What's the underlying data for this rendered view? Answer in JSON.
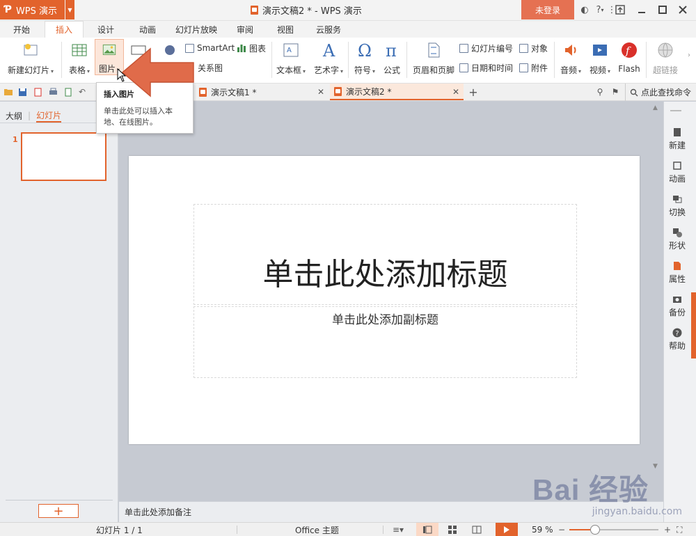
{
  "window": {
    "app_name": "WPS 演示",
    "doc_title": "演示文稿2 * - WPS 演示",
    "login": "未登录",
    "help": "?",
    "help_caret": "▾"
  },
  "tabs": [
    "开始",
    "插入",
    "设计",
    "动画",
    "幻灯片放映",
    "审阅",
    "视图",
    "云服务"
  ],
  "ribbon": {
    "new_slide": "新建幻灯片",
    "table": "表格",
    "picture": "图片",
    "smartart": "SmartArt",
    "chart": "图表",
    "relation": "关系图",
    "textbox": "文本框",
    "wordart": "艺术字",
    "symbol": "符号",
    "formula": "公式",
    "header_footer": "页眉和页脚",
    "slide_number": "幻灯片编号",
    "datetime": "日期和时间",
    "object": "对象",
    "attachment": "附件",
    "audio": "音频",
    "video": "视频",
    "flash": "Flash",
    "hyperlink": "超链接",
    "caret": "▾"
  },
  "doc_tabs": [
    "演示文稿1 *",
    "演示文稿2 *"
  ],
  "find_command": "点此查找命令",
  "tooltip": {
    "title": "插入图片",
    "body": "单击此处可以插入本地、在线图片。"
  },
  "left_panel": {
    "outline": "大纲",
    "slides": "幻灯片",
    "thumb_number": "1",
    "add": "+"
  },
  "slide": {
    "title_placeholder": "单击此处添加标题",
    "subtitle_placeholder": "单击此处添加副标题"
  },
  "notes": "单击此处添加备注",
  "right_panel": [
    "新建",
    "动画",
    "切换",
    "形状",
    "属性",
    "备份",
    "帮助"
  ],
  "status": {
    "slide_info": "幻灯片 1 / 1",
    "theme": "Office 主题",
    "zoom": "59 %",
    "minus": "−",
    "plus": "+"
  },
  "watermark": {
    "brand": "Bai 经验",
    "url": "jingyan.baidu.com"
  },
  "colors": {
    "accent": "#e2632c",
    "arrow": "#e06b4a"
  }
}
